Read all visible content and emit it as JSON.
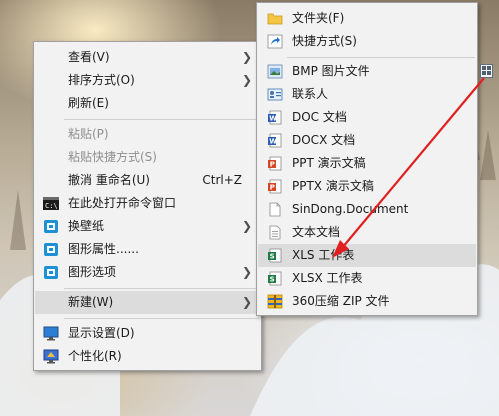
{
  "context_menu": {
    "items": [
      {
        "label": "查看(V)",
        "has_submenu": true
      },
      {
        "label": "排序方式(O)",
        "has_submenu": true
      },
      {
        "label": "刷新(E)"
      },
      {
        "label": "粘贴(P)",
        "disabled": true
      },
      {
        "label": "粘贴快捷方式(S)",
        "disabled": true
      },
      {
        "label": "撤消 重命名(U)",
        "shortcut": "Ctrl+Z"
      },
      {
        "label": "在此处打开命令窗口",
        "icon": "cmd-icon"
      },
      {
        "label": "换壁纸",
        "icon": "graphics-icon",
        "has_submenu": true
      },
      {
        "label": "图形属性......",
        "icon": "graphics-icon"
      },
      {
        "label": "图形选项",
        "icon": "graphics-icon",
        "has_submenu": true
      },
      {
        "label": "新建(W)",
        "has_submenu": true,
        "highlighted": true
      },
      {
        "label": "显示设置(D)",
        "icon": "display-icon"
      },
      {
        "label": "个性化(R)",
        "icon": "personalize-icon"
      }
    ]
  },
  "new_submenu": {
    "items": [
      {
        "label": "文件夹(F)",
        "icon": "folder-icon"
      },
      {
        "label": "快捷方式(S)",
        "icon": "shortcut-icon"
      },
      {
        "label": "BMP 图片文件",
        "icon": "bmp-icon"
      },
      {
        "label": "联系人",
        "icon": "contact-icon"
      },
      {
        "label": "DOC 文档",
        "icon": "word-icon"
      },
      {
        "label": "DOCX 文档",
        "icon": "word-icon"
      },
      {
        "label": "PPT 演示文稿",
        "icon": "ppt-icon"
      },
      {
        "label": "PPTX 演示文稿",
        "icon": "ppt-icon"
      },
      {
        "label": "SinDong.Document",
        "icon": "blank-document-icon"
      },
      {
        "label": "文本文档",
        "icon": "text-document-icon"
      },
      {
        "label": "XLS 工作表",
        "icon": "excel-icon",
        "highlighted": true
      },
      {
        "label": "XLSX 工作表",
        "icon": "excel-icon"
      },
      {
        "label": "360压缩 ZIP 文件",
        "icon": "zip-icon"
      }
    ]
  },
  "colors": {
    "menu_bg": "#f2f2f2",
    "highlight_bg": "#dcdcdc",
    "disabled_text": "#8f8f8f",
    "annotation_arrow": "#e02020"
  }
}
